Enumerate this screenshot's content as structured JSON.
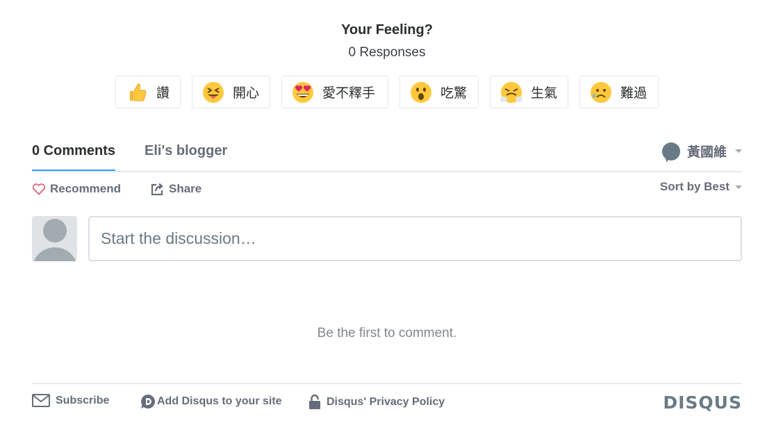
{
  "reactions_header": {
    "title": "Your Feeling?",
    "responses": "0 Responses"
  },
  "reactions": [
    {
      "label": "讚",
      "icon": "thumbs-up-emoji"
    },
    {
      "label": "開心",
      "icon": "tongue-squint-emoji"
    },
    {
      "label": "愛不釋手",
      "icon": "heart-eyes-emoji"
    },
    {
      "label": "吃驚",
      "icon": "surprised-emoji"
    },
    {
      "label": "生氣",
      "icon": "angry-steam-emoji"
    },
    {
      "label": "難過",
      "icon": "sad-tear-emoji"
    }
  ],
  "tabs": {
    "comments": "0 Comments",
    "community": "Eli's blogger"
  },
  "user": {
    "name": "黃國維",
    "icon": "chat-bubble-icon"
  },
  "actions": {
    "recommend": "Recommend",
    "share": "Share",
    "sort": "Sort by Best"
  },
  "composer": {
    "placeholder": "Start the discussion…"
  },
  "empty_message": "Be the first to comment.",
  "footer": {
    "subscribe": "Subscribe",
    "add_disqus": "Add Disqus to your site",
    "privacy": "Disqus' Privacy Policy",
    "brand": "DISQUS"
  },
  "colors": {
    "accent": "#2e9fff",
    "text_muted": "#656c7a",
    "heart": "#e0556b"
  }
}
